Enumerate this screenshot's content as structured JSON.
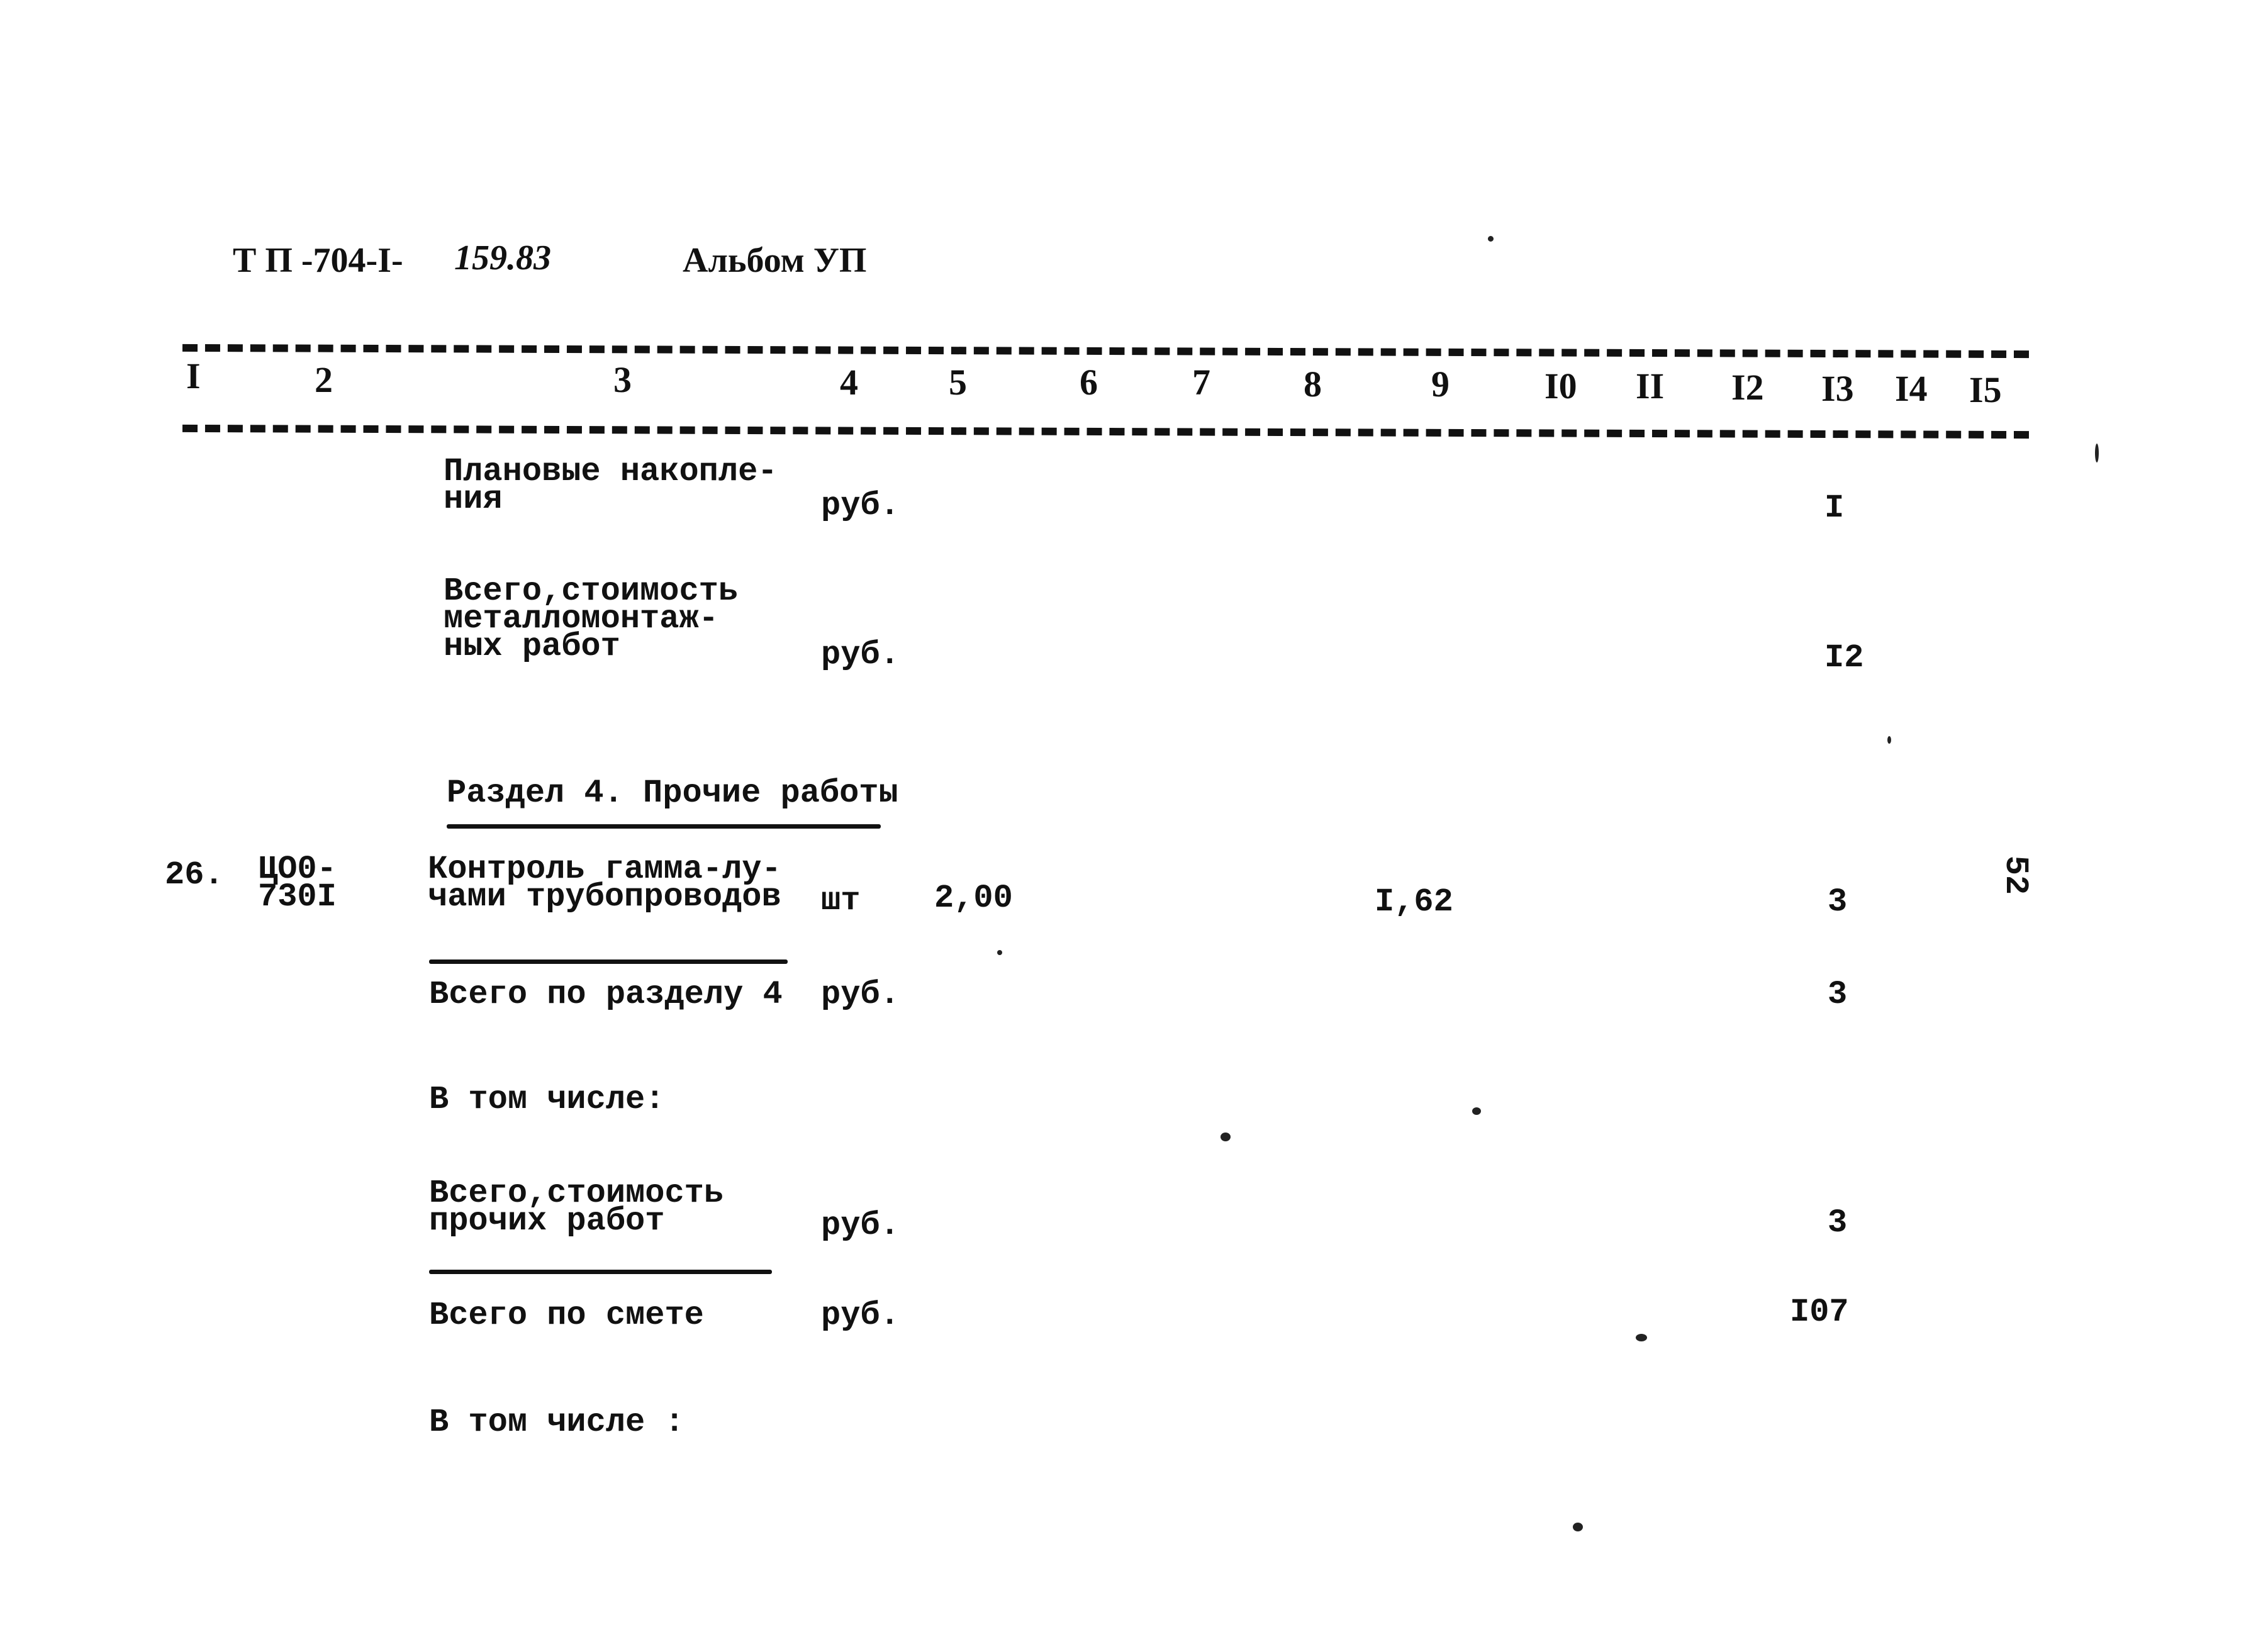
{
  "header": {
    "doc_code": "Т П -704-I-",
    "doc_code_handwritten": "159.83",
    "album": "Альбом УП"
  },
  "columns": [
    "I",
    "2",
    "3",
    "4",
    "5",
    "6",
    "7",
    "8",
    "9",
    "I0",
    "II",
    "I2",
    "I3",
    "I4",
    "I5"
  ],
  "rows": [
    {
      "name": "Плановые накопле-\nния",
      "unit": "руб.",
      "col13": "I"
    },
    {
      "name": "Всего,стоимость\nметалломонтаж-\nных работ",
      "unit": "руб.",
      "col13": "I2"
    },
    {
      "section_title": "Раздел 4. Прочие работы"
    },
    {
      "num": "26.",
      "code": "ЦО0-\n730I",
      "name": "Контроль гамма-лу-\nчами трубопроводов",
      "unit": "шт",
      "col5": "2,00",
      "col9": "I,62",
      "col13": "3"
    },
    {
      "name": "Всего по разделу 4",
      "unit": "руб.",
      "col13": "3"
    },
    {
      "name": "В том числе:"
    },
    {
      "name": "Всего,стоимость\nпрочих работ",
      "unit": "руб.",
      "col13": "3"
    },
    {
      "name": "Всего по смете",
      "unit": "руб.",
      "col13": "I07"
    },
    {
      "name": "В том числе :"
    }
  ],
  "page_number": "52"
}
